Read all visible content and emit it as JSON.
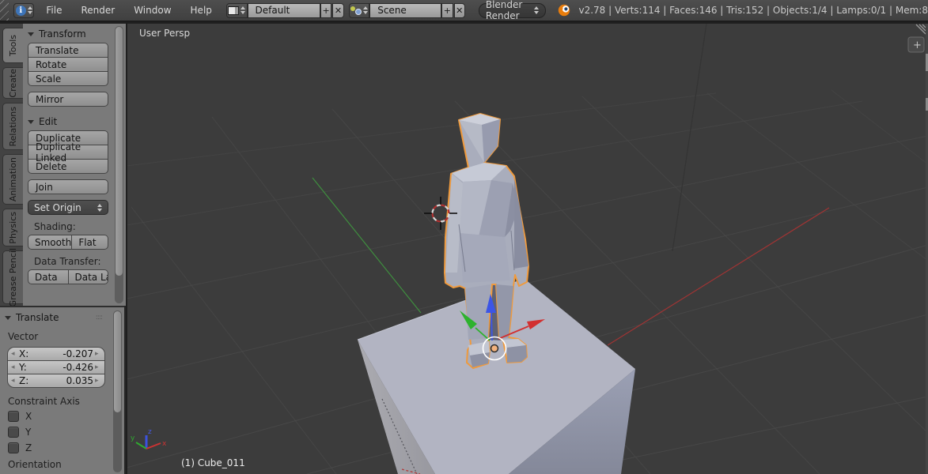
{
  "top_bar": {
    "menus": [
      {
        "label": "File"
      },
      {
        "label": "Render"
      },
      {
        "label": "Window"
      },
      {
        "label": "Help"
      }
    ],
    "layout_selector": {
      "value": "Default",
      "add_label": "+",
      "close_label": "✕"
    },
    "scene_selector": {
      "value": "Scene",
      "add_label": "+",
      "close_label": "✕"
    },
    "engine_selector": {
      "value": "Blender Render"
    },
    "stats": "v2.78 | Verts:114 | Faces:146 | Tris:152 | Objects:1/4 | Lamps:0/1 | Mem:8"
  },
  "tool_shelf": {
    "tabs": [
      {
        "label": "Tools"
      },
      {
        "label": "Create"
      },
      {
        "label": "Relations"
      },
      {
        "label": "Animation"
      },
      {
        "label": "Physics"
      },
      {
        "label": "Grease Pencil"
      }
    ],
    "transform_panel": {
      "title": "Transform",
      "buttons": [
        "Translate",
        "Rotate",
        "Scale"
      ],
      "mirror_label": "Mirror"
    },
    "edit_panel": {
      "title": "Edit",
      "buttons": [
        "Duplicate",
        "Duplicate Linked",
        "Delete"
      ],
      "join_label": "Join",
      "set_origin_label": "Set Origin",
      "shading_label": "Shading:",
      "smooth_label": "Smooth",
      "flat_label": "Flat",
      "data_transfer_label": "Data Transfer:",
      "data_label": "Data",
      "data_layout_label": "Data La"
    }
  },
  "redo_panel": {
    "title": "Translate",
    "vector_label": "Vector",
    "fields": [
      {
        "label": "X:",
        "value": "-0.207"
      },
      {
        "label": "Y:",
        "value": "-0.426"
      },
      {
        "label": "Z:",
        "value": "0.035"
      }
    ],
    "constraint_label": "Constraint Axis",
    "axes": [
      {
        "label": "X"
      },
      {
        "label": "Y"
      },
      {
        "label": "Z"
      }
    ],
    "orientation_label": "Orientation"
  },
  "viewport": {
    "view_label": "User Persp",
    "object_label": "(1) Cube_011",
    "add_panel_label": "+",
    "axis_widget": {
      "x": "x",
      "y": "y",
      "z": "z"
    },
    "colors": {
      "background": "#3c3c3c",
      "selection_outline": "#ef9a3d",
      "axis_x": "#a03434",
      "axis_y": "#3f8f3f",
      "gizmo_x": "#d23030",
      "gizmo_y": "#2db22d",
      "gizmo_z": "#3c55e6",
      "object_fill": "#a9adbc",
      "pedestal_top": "#b2b4c2"
    }
  }
}
